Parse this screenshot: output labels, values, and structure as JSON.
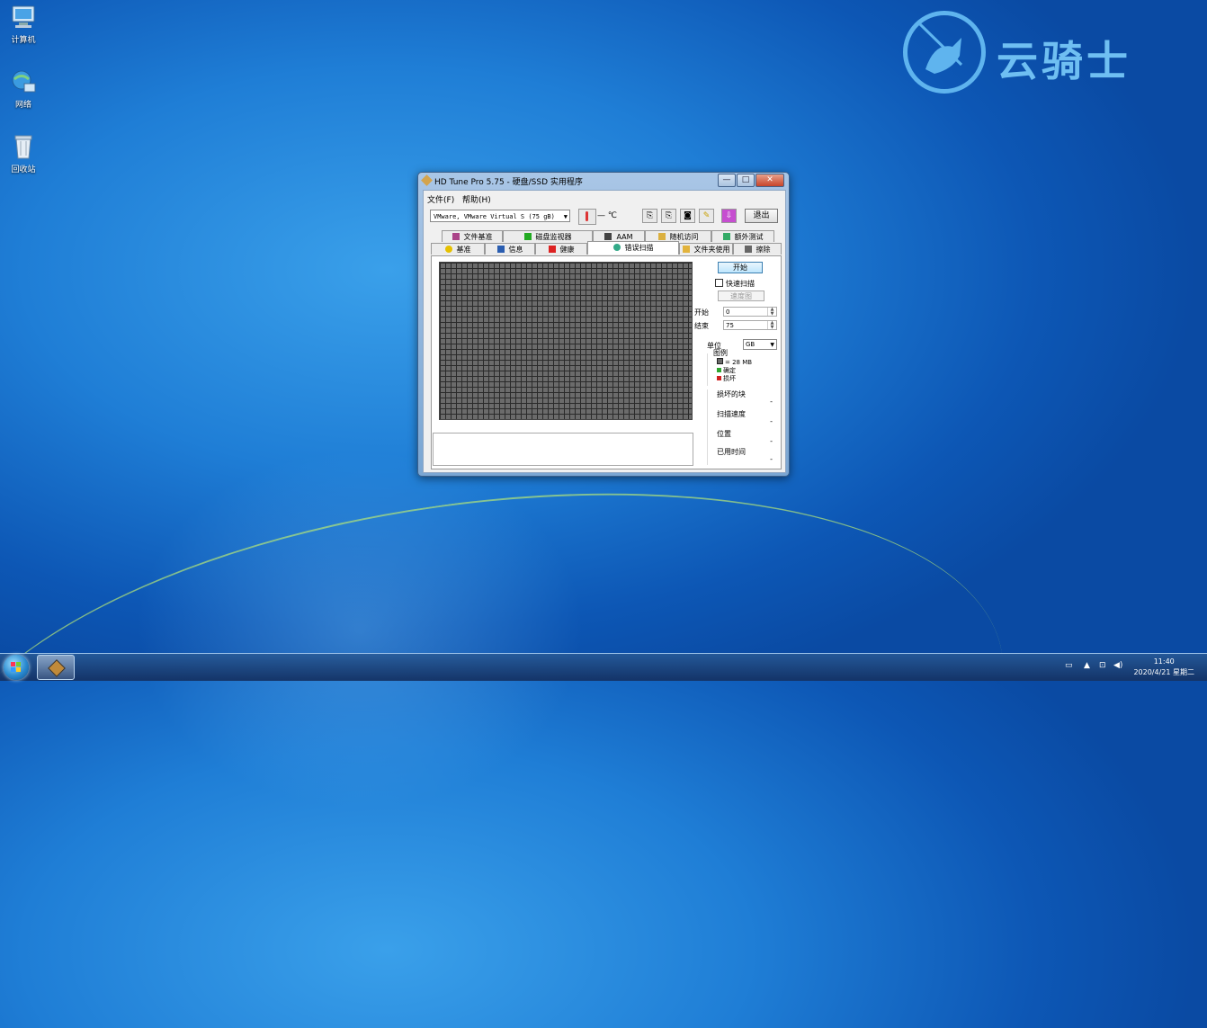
{
  "desktop": {
    "icons": [
      {
        "label": "计算机",
        "icon": "computer-icon"
      },
      {
        "label": "网络",
        "icon": "network-icon"
      },
      {
        "label": "回收站",
        "icon": "recycle-bin-icon"
      }
    ],
    "watermark_text": "云骑士"
  },
  "window": {
    "title": "HD Tune Pro 5.75 - 硬盘/SSD 实用程序",
    "controls": {
      "minimize": "—",
      "maximize": "□",
      "close": "✕"
    },
    "menu": [
      "文件(F)",
      "帮助(H)"
    ],
    "toolbar": {
      "drive": "VMware, VMware Virtual S (75 gB)",
      "temperature": "— ℃",
      "exit_label": "退出"
    },
    "tabs_row1": [
      "文件基准",
      "磁盘监视器",
      "AAM",
      "随机访问",
      "额外测试"
    ],
    "tabs_row2": [
      "基准",
      "信息",
      "健康",
      "错误扫描",
      "文件夹使用",
      "擦除"
    ],
    "active_tab": "错误扫描",
    "error_scan": {
      "start_label": "开始",
      "quick_scan_label": "快速扫描",
      "map_label": "速度图",
      "start_field_label": "开始",
      "start_value": "0",
      "end_field_label": "结束",
      "end_value": "75",
      "unit_label": "单位",
      "unit_value": "GB",
      "legend_title": "图例",
      "legend": [
        {
          "label": "= 28 MB",
          "color": "#6b6b6b"
        },
        {
          "label": "确定",
          "color": "#2fa52f"
        },
        {
          "label": "损坏",
          "color": "#d02020"
        }
      ],
      "stats": [
        {
          "label": "损坏的块",
          "value": "-"
        },
        {
          "label": "扫描速度",
          "value": "-"
        },
        {
          "label": "位置",
          "value": "-"
        },
        {
          "label": "已用时间",
          "value": "-"
        }
      ]
    }
  },
  "taskbar": {
    "time": "11:40",
    "date": "2020/4/21 星期二"
  }
}
